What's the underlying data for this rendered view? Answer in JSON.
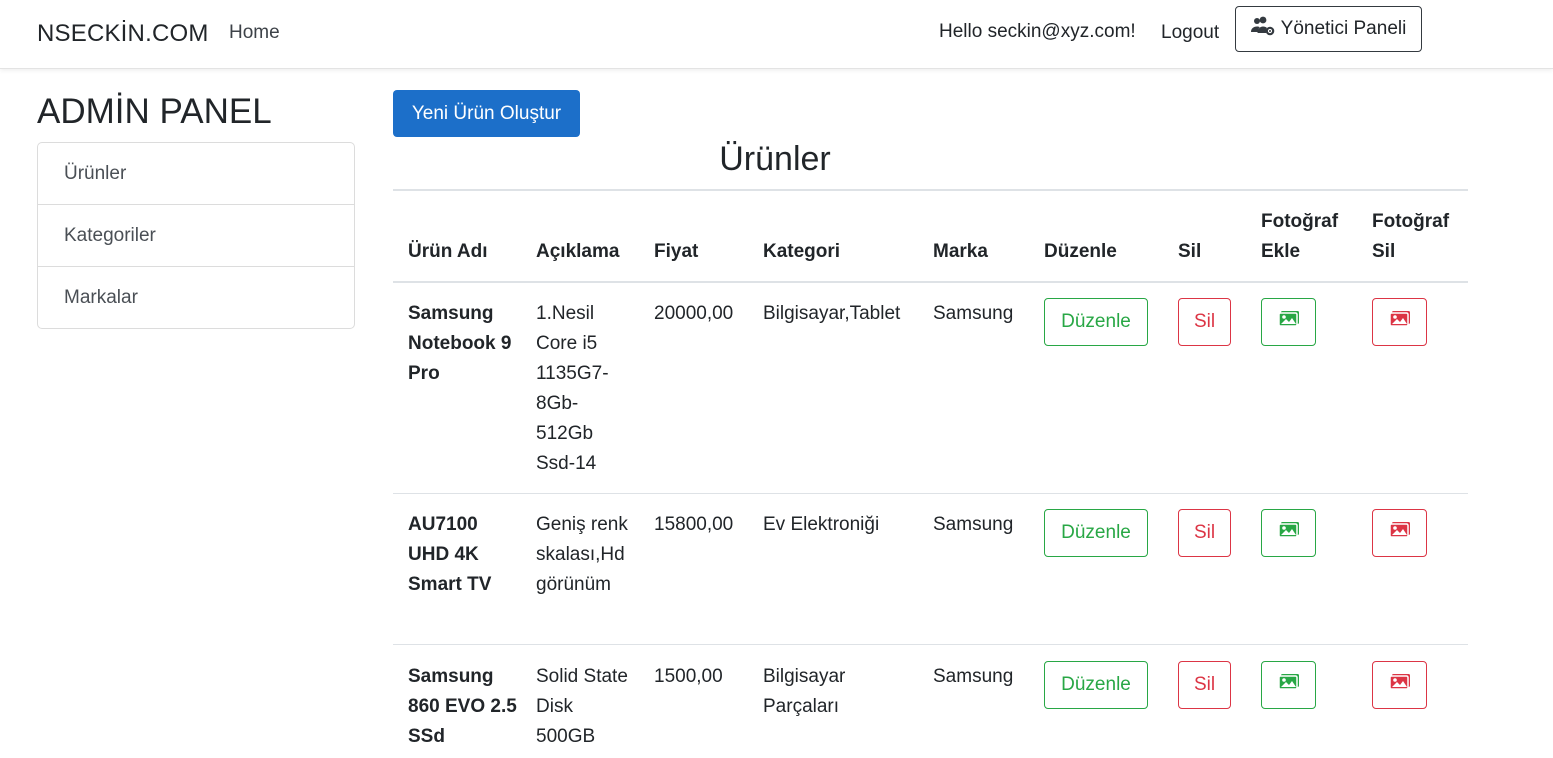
{
  "navbar": {
    "brand": "NSECKİN.COM",
    "home": "Home",
    "hello": "Hello seckin@xyz.com!",
    "logout": "Logout",
    "admin_panel": "Yönetici Paneli",
    "admin_icon": "users-cog-icon"
  },
  "sidebar": {
    "title": "ADMİN PANEL",
    "items": [
      {
        "label": "Ürünler"
      },
      {
        "label": "Kategoriler"
      },
      {
        "label": "Markalar"
      }
    ]
  },
  "main": {
    "new_button": "Yeni Ürün Oluştur",
    "heading": "Ürünler",
    "columns": {
      "name": "Ürün Adı",
      "description": "Açıklama",
      "price": "Fiyat",
      "category": "Kategori",
      "brand": "Marka",
      "edit": "Düzenle",
      "delete": "Sil",
      "add_photo": "Fotoğraf Ekle",
      "delete_photo": "Fotoğraf Sil"
    },
    "rows": [
      {
        "name": "Samsung Notebook 9 Pro",
        "description": "1.Nesil Core i5 1135G7-8Gb-512Gb Ssd-14",
        "price": "20000,00",
        "category": "Bilgisayar,Tablet",
        "brand": "Samsung",
        "edit_label": "Düzenle",
        "delete_label": "Sil"
      },
      {
        "name": "AU7100 UHD 4K Smart TV",
        "description": "Geniş renk skalası,Hd görünüm",
        "price": "15800,00",
        "category": "Ev Elektroniği",
        "brand": "Samsung",
        "edit_label": "Düzenle",
        "delete_label": "Sil"
      },
      {
        "name": "Samsung 860 EVO 2.5 SSd",
        "description": "Solid State Disk 500GB",
        "price": "1500,00",
        "category": "Bilgisayar Parçaları",
        "brand": "Samsung",
        "edit_label": "Düzenle",
        "delete_label": "Sil"
      }
    ],
    "icons": {
      "add_photo": "image-icon",
      "delete_photo": "image-icon"
    }
  },
  "colors": {
    "primary": "#1c6fc9",
    "success": "#28a745",
    "danger": "#dc3545"
  }
}
